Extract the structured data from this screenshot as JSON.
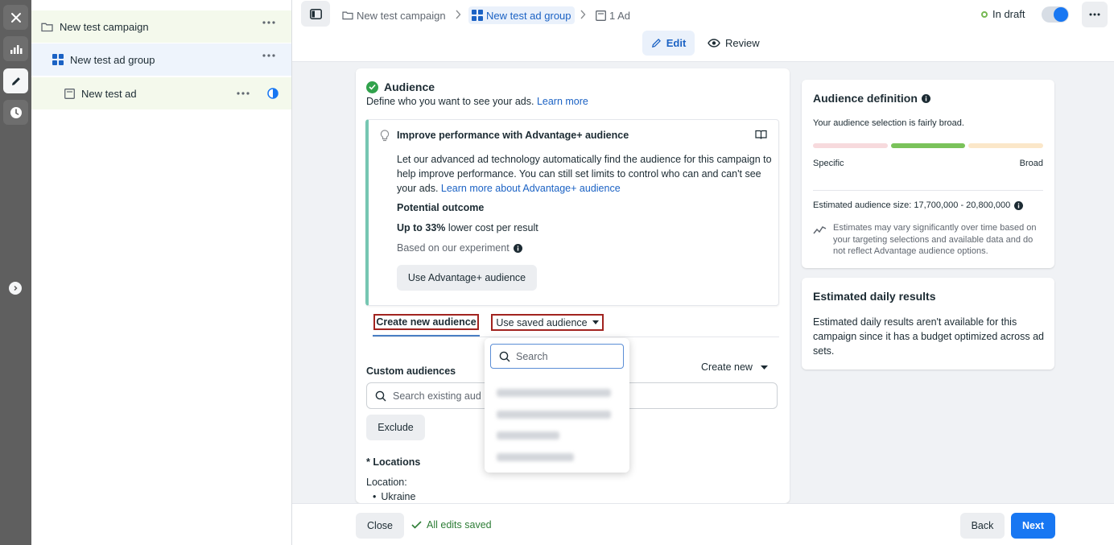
{
  "rail": {
    "icons": [
      "close-icon",
      "chart-icon",
      "pencil-icon",
      "clock-icon",
      "chevron-right-icon"
    ]
  },
  "tree": {
    "campaign": "New test campaign",
    "ad_group": "New test ad group",
    "ad": "New test ad"
  },
  "breadcrumb": {
    "campaign": "New test campaign",
    "ad_group": "New test ad group",
    "ad": "1 Ad"
  },
  "status": {
    "draft_label": "In draft",
    "toggle_on": true
  },
  "modes": {
    "edit": "Edit",
    "review": "Review"
  },
  "audience": {
    "title": "Audience",
    "description": "Define who you want to see your ads.",
    "learn_more": "Learn more"
  },
  "advantage": {
    "heading": "Improve performance with Advantage+ audience",
    "body": "Let our advanced ad technology automatically find the audience for this campaign to help improve performance. You can still set limits to control who can and can't see your ads.",
    "body_link": "Learn more about Advantage+ audience",
    "potential_title": "Potential outcome",
    "upto_bold": "Up to 33%",
    "upto_rest": " lower cost per result",
    "based_on": "Based on our experiment",
    "button": "Use Advantage+ audience"
  },
  "tabs": {
    "create_new": "Create new audience",
    "use_saved": "Use saved audience"
  },
  "dropdown": {
    "search_placeholder": "Search"
  },
  "custom_audiences": {
    "label": "Custom audiences",
    "create_new": "Create new",
    "search_placeholder": "Search existing aud",
    "exclude": "Exclude"
  },
  "locations": {
    "label": "* Locations",
    "sublabel": "Location:",
    "items": [
      "Ukraine"
    ]
  },
  "audience_definition": {
    "title": "Audience definition",
    "subtitle": "Your audience selection is fairly broad.",
    "specific": "Specific",
    "broad": "Broad",
    "estimated_size": "Estimated audience size: 17,700,000 - 20,800,000",
    "note": "Estimates may vary significantly over time based on your targeting selections and available data and do not reflect Advantage audience options."
  },
  "daily_results": {
    "title": "Estimated daily results",
    "body": "Estimated daily results aren't available for this campaign since it has a budget optimized across ad sets."
  },
  "footer": {
    "close": "Close",
    "saved": "All edits saved",
    "back": "Back",
    "next": "Next"
  },
  "colors": {
    "accent": "#1877f2",
    "link": "#1b62c4",
    "success": "#31a24c",
    "highlight_border": "#a1231f"
  }
}
